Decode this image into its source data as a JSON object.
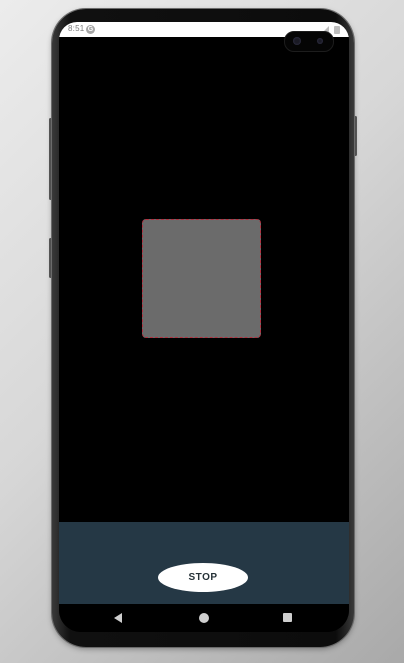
{
  "status_bar": {
    "time": "8:51",
    "notification_icon": "g-icon",
    "right_icons": [
      "signal-icon",
      "battery-icon"
    ]
  },
  "main": {
    "square": {
      "fill_color": "#6b6b6b",
      "border_color": "#b0303f"
    }
  },
  "bottom_panel": {
    "background_color": "#253845",
    "stop_label": "STOP"
  },
  "nav_bar": {
    "back_icon": "back-triangle-icon",
    "home_icon": "home-circle-icon",
    "recents_icon": "recents-square-icon"
  }
}
